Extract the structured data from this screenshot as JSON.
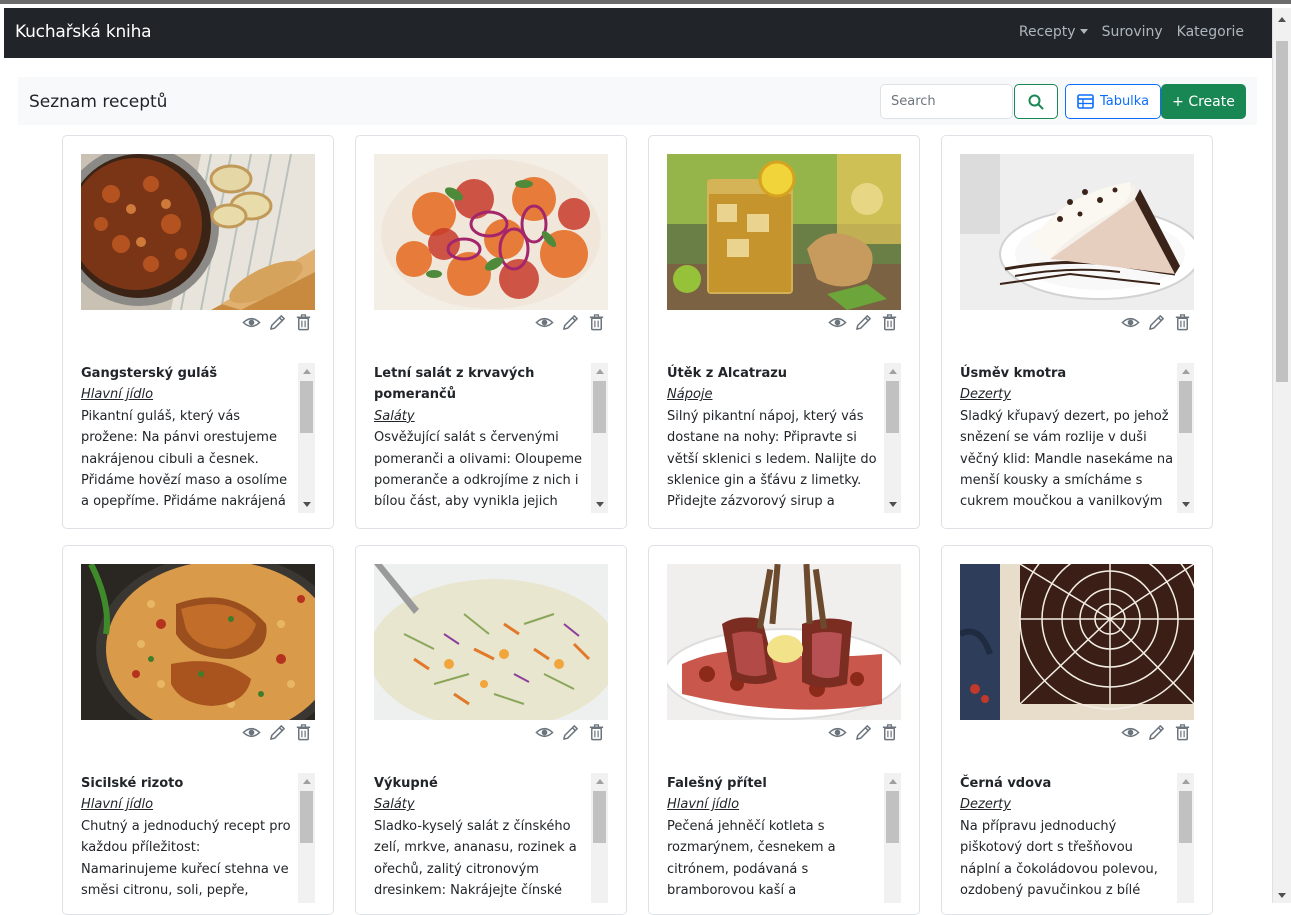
{
  "navbar": {
    "brand": "Kuchařská kniha",
    "links": [
      {
        "label": "Recepty",
        "dropdown": true
      },
      {
        "label": "Suroviny",
        "dropdown": false
      },
      {
        "label": "Kategorie",
        "dropdown": false
      }
    ]
  },
  "header": {
    "title": "Seznam receptů",
    "search_placeholder": "Search",
    "table_button": "Tabulka",
    "create_button": "+ Create"
  },
  "colors": {
    "navbar_bg": "#212529",
    "success": "#198754",
    "primary": "#0d6efd"
  },
  "recipes": [
    {
      "title": "Gangsterský guláš",
      "category": "Hlavní jídlo",
      "description": "Pikantní guláš, který vás prožene: Na pánvi orestujeme nakrájenou cibuli a česnek. Přidáme hovězí maso a osolíme a opepříme. Přidáme nakrájená rajčata a",
      "image": "goulash-photo"
    },
    {
      "title": "Letní salát z krvavých pomerančů",
      "category": "Saláty",
      "description": "Osvěžující salát s červenými pomeranči a olivami: Oloupeme pomeranče a odkrojíme z nich i bílou část, aby vynikla jejich",
      "image": "blood-orange-salad-photo"
    },
    {
      "title": "Útěk z Alcatrazu",
      "category": "Nápoje",
      "description": "Silný pikantní nápoj, který vás dostane na nohy: Připravte si větší sklenici s ledem. Nalijte do sklenice gin a šťávu z limetky. Přidejte zázvorový sirup a",
      "image": "ginger-drink-photo"
    },
    {
      "title": "Úsměv kmotra",
      "category": "Dezerty",
      "description": "Sladký křupavý dezert, po jehož snězení se vám rozlije v duši věčný klid: Mandle nasekáme na menší kousky a smícháme s cukrem moučkou a vanilkovým cukrem.",
      "image": "pie-slice-photo"
    },
    {
      "title": "Sicilské rizoto",
      "category": "Hlavní jídlo",
      "description": "Chutný a jednoduchý recept pro každou příležitost: Namarinujeme kuřecí stehna ve směsi citronu, soli, pepře, čerstvě utřeného",
      "image": "chicken-risotto-photo"
    },
    {
      "title": "Výkupné",
      "category": "Saláty",
      "description": "Sladko-kyselý salát z čínského zelí, mrkve, ananasu, rozinek a ořechů, zalitý citronovým dresinkem: Nakrájejte čínské zelí na tenké",
      "image": "cabbage-salad-photo"
    },
    {
      "title": "Falešný přítel",
      "category": "Hlavní jídlo",
      "description": "Pečená jehněčí kotleta s rozmarýnem, česnekem a citrónem, podávaná s bramborovou kaší a zeleninovým",
      "image": "lamb-rack-photo"
    },
    {
      "title": "Černá vdova",
      "category": "Dezerty",
      "description": "Na přípravu jednoduchý piškotový dort s třešňovou náplní a čokoládovou polevou, ozdobený pavučinkou z bílé čokolády:",
      "image": "spiderweb-cake-photo"
    }
  ]
}
